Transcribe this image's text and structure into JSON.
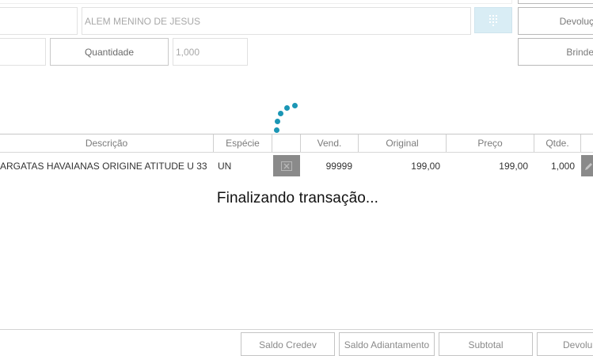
{
  "form": {
    "client_name": "ALEM MENINO DE JESUS",
    "quantity_label": "Quantidade",
    "quantity_value": "1,000",
    "devolucao_button": "Devoluç",
    "brinde_button": "Brinde"
  },
  "icons": {
    "keypad": "keypad-icon",
    "delete": "close-icon",
    "edit": "pencil-icon"
  },
  "table": {
    "headers": {
      "descricao": "Descrição",
      "especie": "Espécie",
      "vend": "Vend.",
      "original": "Original",
      "preco": "Preço",
      "qtde": "Qtde."
    },
    "rows": [
      {
        "descricao": "ARGATAS HAVAIANAS ORIGINE ATITUDE U 33",
        "especie": "UN",
        "vend": "99999",
        "original": "199,00",
        "preco": "199,00",
        "qtde": "1,000"
      }
    ]
  },
  "overlay": {
    "status_text": "Finalizando transação..."
  },
  "footer": {
    "saldo_credev": "Saldo Credev",
    "saldo_adiantamento": "Saldo Adiantamento",
    "subtotal": "Subtotal",
    "devolucao": "Devolu"
  },
  "colors": {
    "spinner": "#1b96b5",
    "keypad_bg": "#d9edf5",
    "row_action_bg": "#8a8a8a"
  }
}
